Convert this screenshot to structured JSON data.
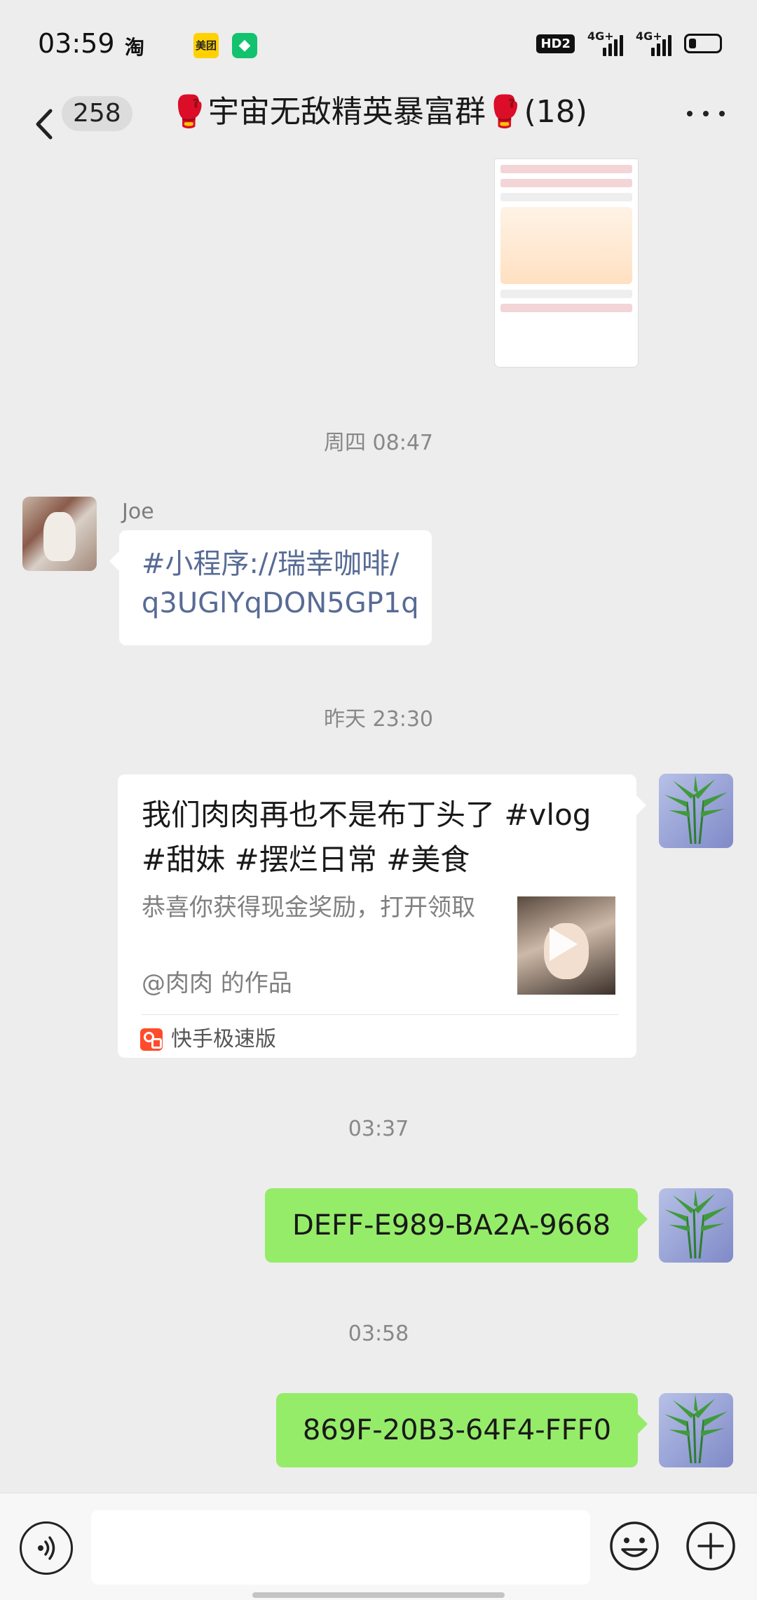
{
  "status_bar": {
    "time": "03:59",
    "taobao": "淘",
    "meituan": "美团",
    "app_icon": "◆",
    "hd": "HD2",
    "network1": "4G+",
    "network2": "4G+"
  },
  "header": {
    "unread_count": "258",
    "title_prefix": "🥊",
    "title": "宇宙无敌精英暴富群",
    "title_suffix": "🥊",
    "member_count": "(18)"
  },
  "messages": {
    "time1": "周四 08:47",
    "joe_name": "Joe",
    "joe_link_line1": "#小程序://瑞幸咖啡/",
    "joe_link_line2": "q3UGlYqDON5GP1q",
    "time2": "昨天 23:30",
    "card": {
      "title": "我们肉肉再也不是布丁头了 #vlog #甜妹 #摆烂日常 #美食",
      "desc": "恭喜你获得现金奖励，打开领取",
      "author": "@肉肉 的作品",
      "source": "快手极速版"
    },
    "time3": "03:37",
    "msg_code1": "DEFF-E989-BA2A-9668",
    "time4": "03:58",
    "msg_code2": "869F-20B3-64F4-FFF0"
  },
  "input": {
    "placeholder": ""
  },
  "colors": {
    "background": "#ededed",
    "green_bubble": "#95ec69",
    "link": "#576b95"
  }
}
